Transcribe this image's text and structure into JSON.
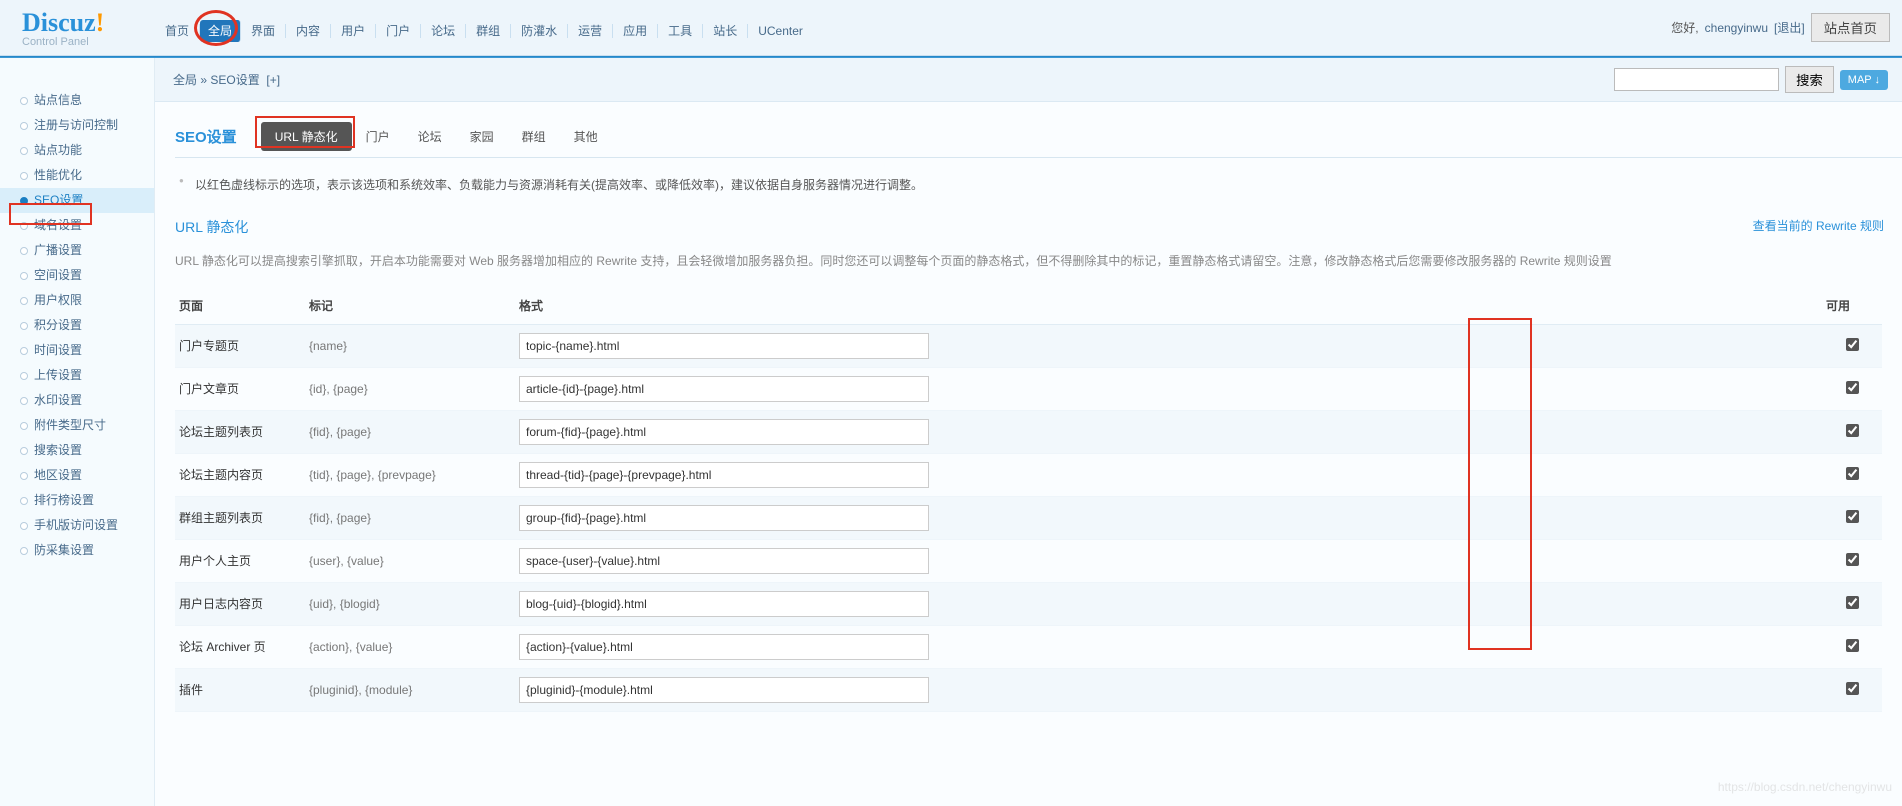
{
  "header": {
    "logo_main": "Discuz",
    "logo_sub": "Control Panel",
    "nav": [
      "首页",
      "全局",
      "界面",
      "内容",
      "用户",
      "门户",
      "论坛",
      "群组",
      "防灌水",
      "运营",
      "应用",
      "工具",
      "站长",
      "UCenter"
    ],
    "nav_active_index": 1,
    "greeting": "您好, ",
    "username": "chengyinwu",
    "logout": "[退出]",
    "site_home": "站点首页"
  },
  "crumb": {
    "a": "全局",
    "sep": " » ",
    "b": "SEO设置",
    "plus": "[+]"
  },
  "search": {
    "placeholder": "",
    "btn": "搜索",
    "map": "MAP ↓"
  },
  "sidebar": {
    "items": [
      "站点信息",
      "注册与访问控制",
      "站点功能",
      "性能优化",
      "SEO设置",
      "域名设置",
      "广播设置",
      "空间设置",
      "用户权限",
      "积分设置",
      "时间设置",
      "上传设置",
      "水印设置",
      "附件类型尺寸",
      "搜索设置",
      "地区设置",
      "排行榜设置",
      "手机版访问设置",
      "防采集设置"
    ],
    "active_index": 4
  },
  "page": {
    "title": "SEO设置",
    "tabs": [
      "URL 静态化",
      "门户",
      "论坛",
      "家园",
      "群组",
      "其他"
    ],
    "tab_active_index": 0,
    "note": "以红色虚线标示的选项，表示该选项和系统效率、负载能力与资源消耗有关(提高效率、或降低效率)，建议依据自身服务器情况进行调整。"
  },
  "section": {
    "title": "URL 静态化",
    "right_link": "查看当前的 Rewrite 规则",
    "desc": "URL 静态化可以提高搜索引擎抓取，开启本功能需要对 Web 服务器增加相应的 Rewrite 支持，且会轻微增加服务器负担。同时您还可以调整每个页面的静态格式，但不得删除其中的标记，重置静态格式请留空。注意，修改静态格式后您需要修改服务器的 Rewrite 规则设置"
  },
  "table": {
    "headers": {
      "page": "页面",
      "tag": "标记",
      "fmt": "格式",
      "avail": "可用"
    },
    "rows": [
      {
        "page": "门户专题页",
        "tag": "{name}",
        "fmt": "topic-{name}.html",
        "checked": true
      },
      {
        "page": "门户文章页",
        "tag": "{id}, {page}",
        "fmt": "article-{id}-{page}.html",
        "checked": true
      },
      {
        "page": "论坛主题列表页",
        "tag": "{fid}, {page}",
        "fmt": "forum-{fid}-{page}.html",
        "checked": true
      },
      {
        "page": "论坛主题内容页",
        "tag": "{tid}, {page}, {prevpage}",
        "fmt": "thread-{tid}-{page}-{prevpage}.html",
        "checked": true
      },
      {
        "page": "群组主题列表页",
        "tag": "{fid}, {page}",
        "fmt": "group-{fid}-{page}.html",
        "checked": true
      },
      {
        "page": "用户个人主页",
        "tag": "{user}, {value}",
        "fmt": "space-{user}-{value}.html",
        "checked": true
      },
      {
        "page": "用户日志内容页",
        "tag": "{uid}, {blogid}",
        "fmt": "blog-{uid}-{blogid}.html",
        "checked": true
      },
      {
        "page": "论坛 Archiver 页",
        "tag": "{action}, {value}",
        "fmt": "{action}-{value}.html",
        "checked": true
      },
      {
        "page": "插件",
        "tag": "{pluginid}, {module}",
        "fmt": "{pluginid}-{module}.html",
        "checked": true
      }
    ]
  },
  "watermark": "https://blog.csdn.net/chengyinwu"
}
